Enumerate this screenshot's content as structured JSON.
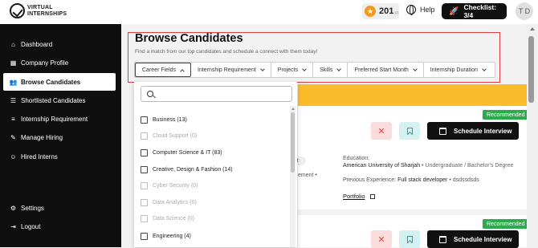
{
  "header": {
    "logo_line1": "VIRTUAL",
    "logo_line2": "INTERNSHIPS",
    "points": "201",
    "points_suffix": "VI",
    "help": "Help",
    "checklist": "Checklist: 3/4",
    "avatar_initials": "T D"
  },
  "sidebar": {
    "items": [
      {
        "label": "Dashboard",
        "icon": "home-icon"
      },
      {
        "label": "Company Profile",
        "icon": "company-icon"
      },
      {
        "label": "Browse Candidates",
        "icon": "people-icon"
      },
      {
        "label": "Shortlisted Candidates",
        "icon": "list-icon"
      },
      {
        "label": "Internship Requirement",
        "icon": "document-icon"
      },
      {
        "label": "Manage Hiring",
        "icon": "edit-icon"
      },
      {
        "label": "Hired Interns",
        "icon": "smile-icon"
      },
      {
        "label": "Settings",
        "icon": "gear-icon"
      },
      {
        "label": "Logout",
        "icon": "logout-icon"
      }
    ],
    "active": "Browse Candidates"
  },
  "main": {
    "title": "Browse Candidates",
    "subtitle": "Find a match from our top candidates and schedule a connect with them today!",
    "filters": [
      "Career Fields",
      "Internship Requirement",
      "Projects",
      "Skills",
      "Preferred Start Month",
      "Internship Duration"
    ]
  },
  "dropdown": {
    "search_placeholder": "",
    "options": [
      {
        "label": "Business (13)",
        "disabled": false
      },
      {
        "label": "Cloud Support (0)",
        "disabled": true
      },
      {
        "label": "Computer Science & IT (83)",
        "disabled": false
      },
      {
        "label": "Creative, Design & Fashion (14)",
        "disabled": false
      },
      {
        "label": "Cyber Security (0)",
        "disabled": true
      },
      {
        "label": "Data Analytics (0)",
        "disabled": true
      },
      {
        "label": "Data Science (0)",
        "disabled": true
      },
      {
        "label": "Engineering (4)",
        "disabled": false
      }
    ]
  },
  "candidate1": {
    "badge": "Recommended",
    "schedule": "Schedule Interview",
    "education_label": "Education:",
    "university": "American University of Sharjah",
    "degree": "Undergraduate / Bachelor's Degree",
    "experience_label": "Previous Experience:",
    "experience_1": "Full stack developer",
    "experience_2": "dsdssdsds",
    "portfolio": "Portfolio",
    "frag_pill": "ent",
    "frag_text": "ement"
  },
  "candidate2": {
    "badge": "Recommended",
    "schedule": "Schedule Interview"
  },
  "colors": {
    "accent_yellow": "#fbbc2c",
    "recommended_green": "#2bab4c",
    "dark": "#111111",
    "reject_bg": "#fadcdc",
    "bookmark_bg": "#d4f1f1"
  }
}
